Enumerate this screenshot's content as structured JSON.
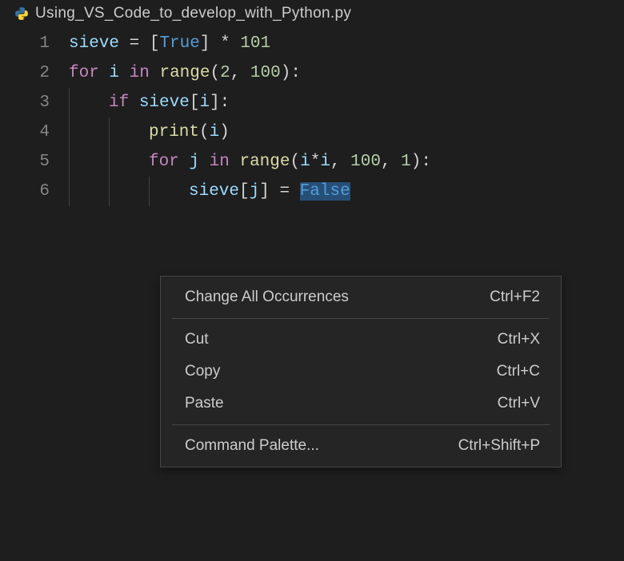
{
  "tab": {
    "filename": "Using_VS_Code_to_develop_with_Python.py",
    "icon": "python-icon"
  },
  "code": {
    "lines": [
      {
        "num": "1",
        "indent": 0,
        "tokens": [
          {
            "t": "sieve",
            "c": "tok-var"
          },
          {
            "t": " ",
            "c": ""
          },
          {
            "t": "=",
            "c": "tok-op"
          },
          {
            "t": " ",
            "c": ""
          },
          {
            "t": "[",
            "c": "tok-brkt"
          },
          {
            "t": "True",
            "c": "tok-const"
          },
          {
            "t": "]",
            "c": "tok-brkt"
          },
          {
            "t": " ",
            "c": ""
          },
          {
            "t": "*",
            "c": "tok-op"
          },
          {
            "t": " ",
            "c": ""
          },
          {
            "t": "101",
            "c": "tok-num"
          }
        ]
      },
      {
        "num": "2",
        "indent": 0,
        "tokens": [
          {
            "t": "for",
            "c": "tok-kw"
          },
          {
            "t": " ",
            "c": ""
          },
          {
            "t": "i",
            "c": "tok-var"
          },
          {
            "t": " ",
            "c": ""
          },
          {
            "t": "in",
            "c": "tok-kw"
          },
          {
            "t": " ",
            "c": ""
          },
          {
            "t": "range",
            "c": "tok-fn"
          },
          {
            "t": "(",
            "c": "tok-brkt"
          },
          {
            "t": "2",
            "c": "tok-num"
          },
          {
            "t": ",",
            "c": "tok-op"
          },
          {
            "t": " ",
            "c": ""
          },
          {
            "t": "100",
            "c": "tok-num"
          },
          {
            "t": ")",
            "c": "tok-brkt"
          },
          {
            "t": ":",
            "c": "tok-op"
          }
        ]
      },
      {
        "num": "3",
        "indent": 1,
        "tokens": [
          {
            "t": "if",
            "c": "tok-kw"
          },
          {
            "t": " ",
            "c": ""
          },
          {
            "t": "sieve",
            "c": "tok-var"
          },
          {
            "t": "[",
            "c": "tok-brkt"
          },
          {
            "t": "i",
            "c": "tok-var"
          },
          {
            "t": "]",
            "c": "tok-brkt"
          },
          {
            "t": ":",
            "c": "tok-op"
          }
        ]
      },
      {
        "num": "4",
        "indent": 2,
        "tokens": [
          {
            "t": "print",
            "c": "tok-fn"
          },
          {
            "t": "(",
            "c": "tok-brkt"
          },
          {
            "t": "i",
            "c": "tok-var"
          },
          {
            "t": ")",
            "c": "tok-brkt"
          }
        ]
      },
      {
        "num": "5",
        "indent": 2,
        "tokens": [
          {
            "t": "for",
            "c": "tok-kw"
          },
          {
            "t": " ",
            "c": ""
          },
          {
            "t": "j",
            "c": "tok-var"
          },
          {
            "t": " ",
            "c": ""
          },
          {
            "t": "in",
            "c": "tok-kw"
          },
          {
            "t": " ",
            "c": ""
          },
          {
            "t": "range",
            "c": "tok-fn"
          },
          {
            "t": "(",
            "c": "tok-brkt"
          },
          {
            "t": "i",
            "c": "tok-var"
          },
          {
            "t": "*",
            "c": "tok-op"
          },
          {
            "t": "i",
            "c": "tok-var"
          },
          {
            "t": ",",
            "c": "tok-op"
          },
          {
            "t": " ",
            "c": ""
          },
          {
            "t": "100",
            "c": "tok-num"
          },
          {
            "t": ",",
            "c": "tok-op"
          },
          {
            "t": " ",
            "c": ""
          },
          {
            "t": "1",
            "c": "tok-num"
          },
          {
            "t": ")",
            "c": "tok-brkt"
          },
          {
            "t": ":",
            "c": "tok-op"
          }
        ]
      },
      {
        "num": "6",
        "indent": 3,
        "tokens": [
          {
            "t": "sieve",
            "c": "tok-var"
          },
          {
            "t": "[",
            "c": "tok-brkt"
          },
          {
            "t": "j",
            "c": "tok-var"
          },
          {
            "t": "]",
            "c": "tok-brkt"
          },
          {
            "t": " ",
            "c": ""
          },
          {
            "t": "=",
            "c": "tok-op"
          },
          {
            "t": " ",
            "c": ""
          },
          {
            "t": "False",
            "c": "tok-const",
            "sel": true
          }
        ]
      }
    ]
  },
  "contextMenu": {
    "groups": [
      [
        {
          "label": "Change All Occurrences",
          "shortcut": "Ctrl+F2"
        }
      ],
      [
        {
          "label": "Cut",
          "shortcut": "Ctrl+X"
        },
        {
          "label": "Copy",
          "shortcut": "Ctrl+C"
        },
        {
          "label": "Paste",
          "shortcut": "Ctrl+V"
        }
      ],
      [
        {
          "label": "Command Palette...",
          "shortcut": "Ctrl+Shift+P"
        }
      ]
    ]
  }
}
